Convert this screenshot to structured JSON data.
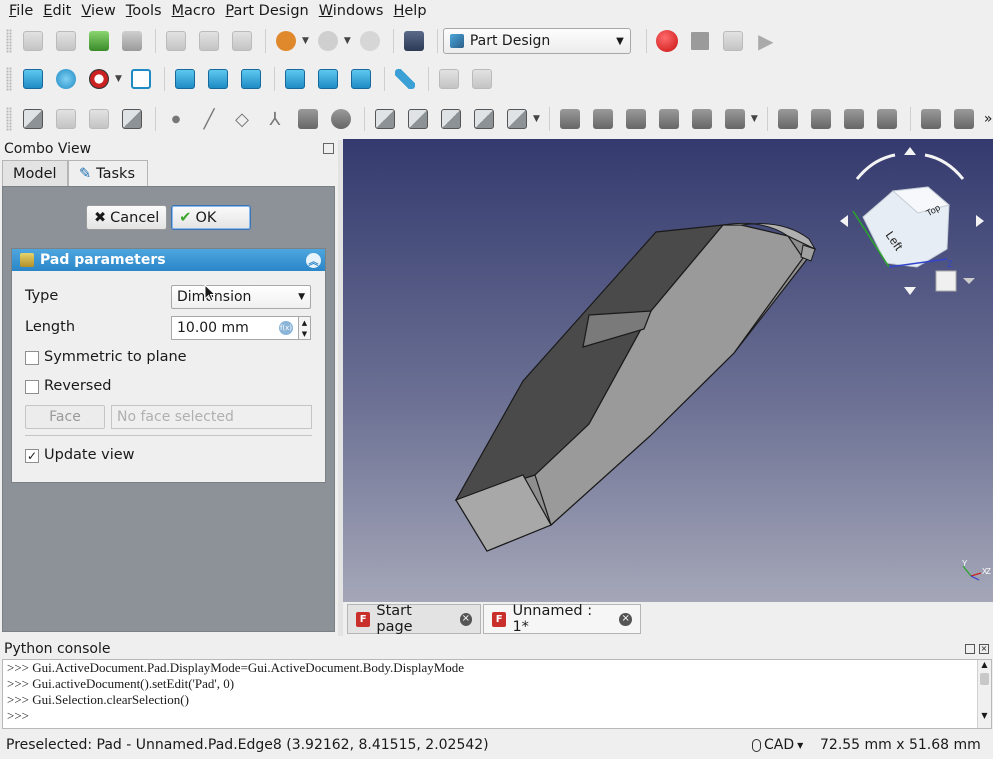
{
  "menu": [
    "File",
    "Edit",
    "View",
    "Tools",
    "Macro",
    "Part Design",
    "Windows",
    "Help"
  ],
  "workbench": {
    "selected": "Part Design"
  },
  "combo_view": {
    "title": "Combo View",
    "tabs": [
      "Model",
      "Tasks"
    ],
    "active_tab": "Tasks"
  },
  "task_buttons": {
    "cancel": "Cancel",
    "ok": "OK"
  },
  "pad": {
    "header": "Pad parameters",
    "type_label": "Type",
    "type_value": "Dimension",
    "length_label": "Length",
    "length_value": "10.00 mm",
    "symmetric_label": "Symmetric to plane",
    "symmetric_checked": false,
    "reversed_label": "Reversed",
    "reversed_checked": false,
    "face_button": "Face",
    "face_placeholder": "No face selected",
    "update_view_label": "Update view",
    "update_view_checked": true
  },
  "navcube": {
    "face_label": "Left",
    "top_label": "Top"
  },
  "axis_labels": {
    "x": "X",
    "y": "Y",
    "z": "Z"
  },
  "doc_tabs": [
    {
      "label": "Start page",
      "active": false
    },
    {
      "label": "Unnamed : 1*",
      "active": true
    }
  ],
  "python_console": {
    "title": "Python console",
    "lines": [
      ">>> Gui.ActiveDocument.Pad.DisplayMode=Gui.ActiveDocument.Body.DisplayMode",
      ">>> Gui.activeDocument().setEdit('Pad', 0)",
      ">>> Gui.Selection.clearSelection()",
      ">>> "
    ]
  },
  "status": {
    "message": "Preselected: Pad - Unnamed.Pad.Edge8 (3.92162, 8.41515, 2.02542)",
    "nav_style": "CAD",
    "dimensions": "72.55 mm x 51.68 mm"
  },
  "colors": {
    "accent_header": "#2a86c8",
    "view_top": "#343a6e",
    "view_bottom": "#a5a7b8",
    "record": "#d62020"
  }
}
